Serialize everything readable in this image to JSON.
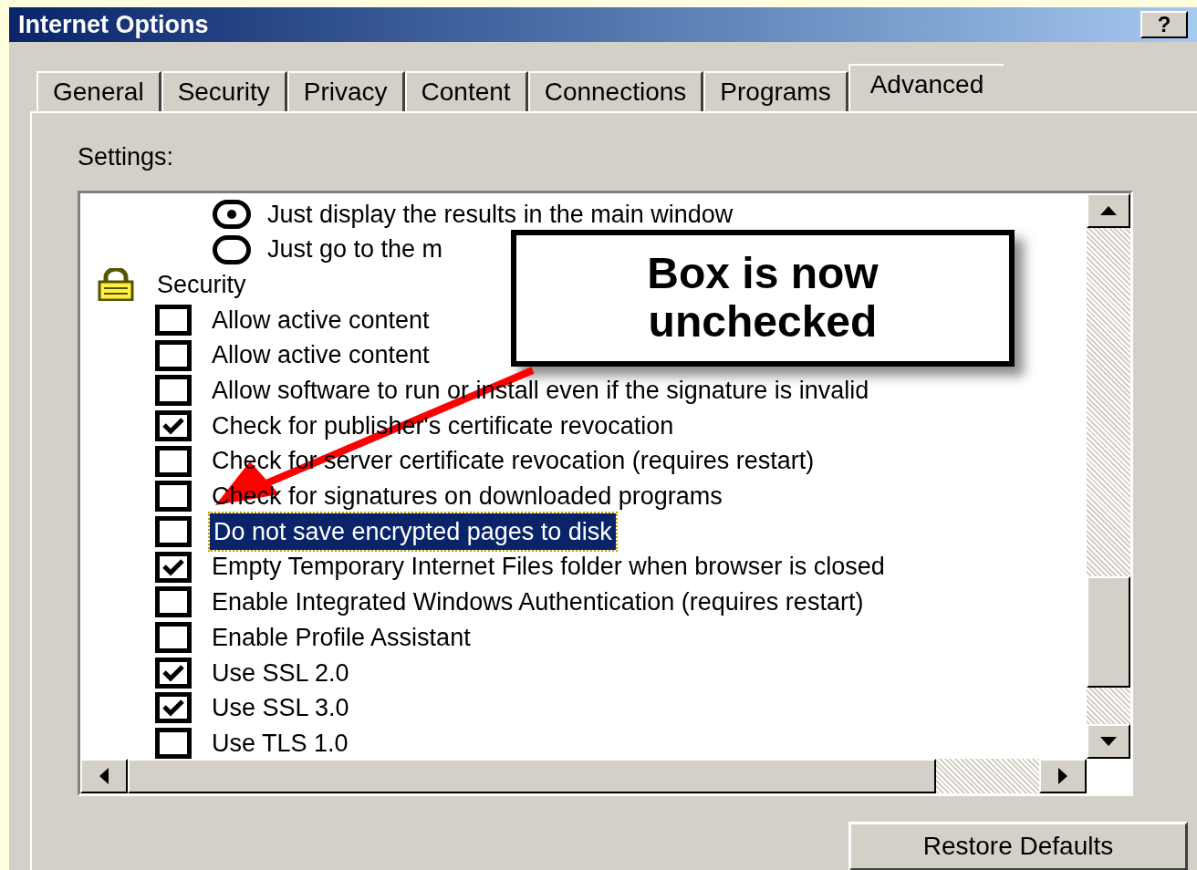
{
  "window": {
    "title": "Internet Options",
    "help_button": "?"
  },
  "tabs": [
    {
      "label": "General",
      "selected": false
    },
    {
      "label": "Security",
      "selected": false
    },
    {
      "label": "Privacy",
      "selected": false
    },
    {
      "label": "Content",
      "selected": false
    },
    {
      "label": "Connections",
      "selected": false
    },
    {
      "label": "Programs",
      "selected": false
    },
    {
      "label": "Advanced",
      "selected": true
    }
  ],
  "settings_label": "Settings:",
  "settings_items": [
    {
      "kind": "radio",
      "label": "Just display the results in the main window",
      "selected": true
    },
    {
      "kind": "radio",
      "label": "Just go to the m",
      "selected": false
    },
    {
      "kind": "group",
      "label": "Security"
    },
    {
      "kind": "checkbox",
      "label": "Allow active content",
      "checked": false,
      "highlighted": false
    },
    {
      "kind": "checkbox",
      "label": "Allow active content",
      "checked": false,
      "highlighted": false
    },
    {
      "kind": "checkbox",
      "label": "Allow software to run or install even if the signature is invalid",
      "checked": false,
      "highlighted": false
    },
    {
      "kind": "checkbox",
      "label": "Check for publisher's certificate revocation",
      "checked": true,
      "highlighted": false
    },
    {
      "kind": "checkbox",
      "label": "Check for server certificate revocation (requires restart)",
      "checked": false,
      "highlighted": false
    },
    {
      "kind": "checkbox",
      "label": "Check for signatures on downloaded programs",
      "checked": false,
      "highlighted": false
    },
    {
      "kind": "checkbox",
      "label": "Do not save encrypted pages to disk",
      "checked": false,
      "highlighted": true
    },
    {
      "kind": "checkbox",
      "label": "Empty Temporary Internet Files folder when browser is closed",
      "checked": true,
      "highlighted": false
    },
    {
      "kind": "checkbox",
      "label": "Enable Integrated Windows Authentication (requires restart)",
      "checked": false,
      "highlighted": false
    },
    {
      "kind": "checkbox",
      "label": "Enable Profile Assistant",
      "checked": false,
      "highlighted": false
    },
    {
      "kind": "checkbox",
      "label": "Use SSL 2.0",
      "checked": true,
      "highlighted": false
    },
    {
      "kind": "checkbox",
      "label": "Use SSL 3.0",
      "checked": true,
      "highlighted": false
    },
    {
      "kind": "checkbox",
      "label": "Use TLS 1.0",
      "checked": false,
      "highlighted": false
    }
  ],
  "callout": {
    "text": "Box is now unchecked"
  },
  "restore_button": "Restore Defaults"
}
